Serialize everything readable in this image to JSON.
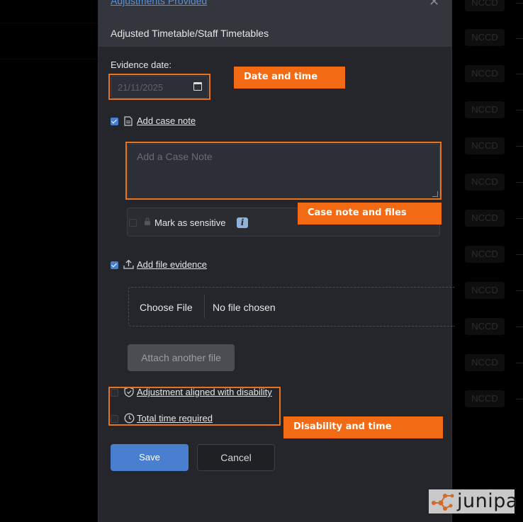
{
  "background": {
    "row_badge": "NCCD",
    "rows": 12
  },
  "modal": {
    "back_link": "Adjustments Provided",
    "subtitle": "Adjusted Timetable/Staff Timetables",
    "evidence_date": {
      "label": "Evidence date:",
      "value": "21/11/2025",
      "icon": "calendar-icon"
    },
    "case_note": {
      "checked": true,
      "label": "Add case note",
      "icon": "document-icon",
      "placeholder": "Add a Case Note",
      "sensitive_label": "Mark as sensitive",
      "sensitive_checked": false,
      "lock_icon": "lock-icon",
      "info_icon": "i"
    },
    "file_evidence": {
      "checked": true,
      "label": "Add file evidence",
      "icon": "upload-icon",
      "choose_label": "Choose File",
      "no_file_label": "No file chosen",
      "attach_label": "Attach another file"
    },
    "disability": {
      "checked": false,
      "label": "Adjustment aligned with disability",
      "icon": "shield-check-icon"
    },
    "time": {
      "checked": false,
      "label": "Total time required",
      "icon": "clock-icon"
    },
    "save_label": "Save",
    "cancel_label": "Cancel"
  },
  "annotations": {
    "date_time": "Date and time",
    "case_note_files": "Case note and files",
    "disability_time": "Disability and time",
    "highlight_color": "#e8731b",
    "callout_color": "#f26a14"
  },
  "watermark": {
    "text": "junipa"
  },
  "colors": {
    "accent": "#4a7fd0",
    "modal_bg": "#24262b",
    "header_bg": "#33363c"
  }
}
